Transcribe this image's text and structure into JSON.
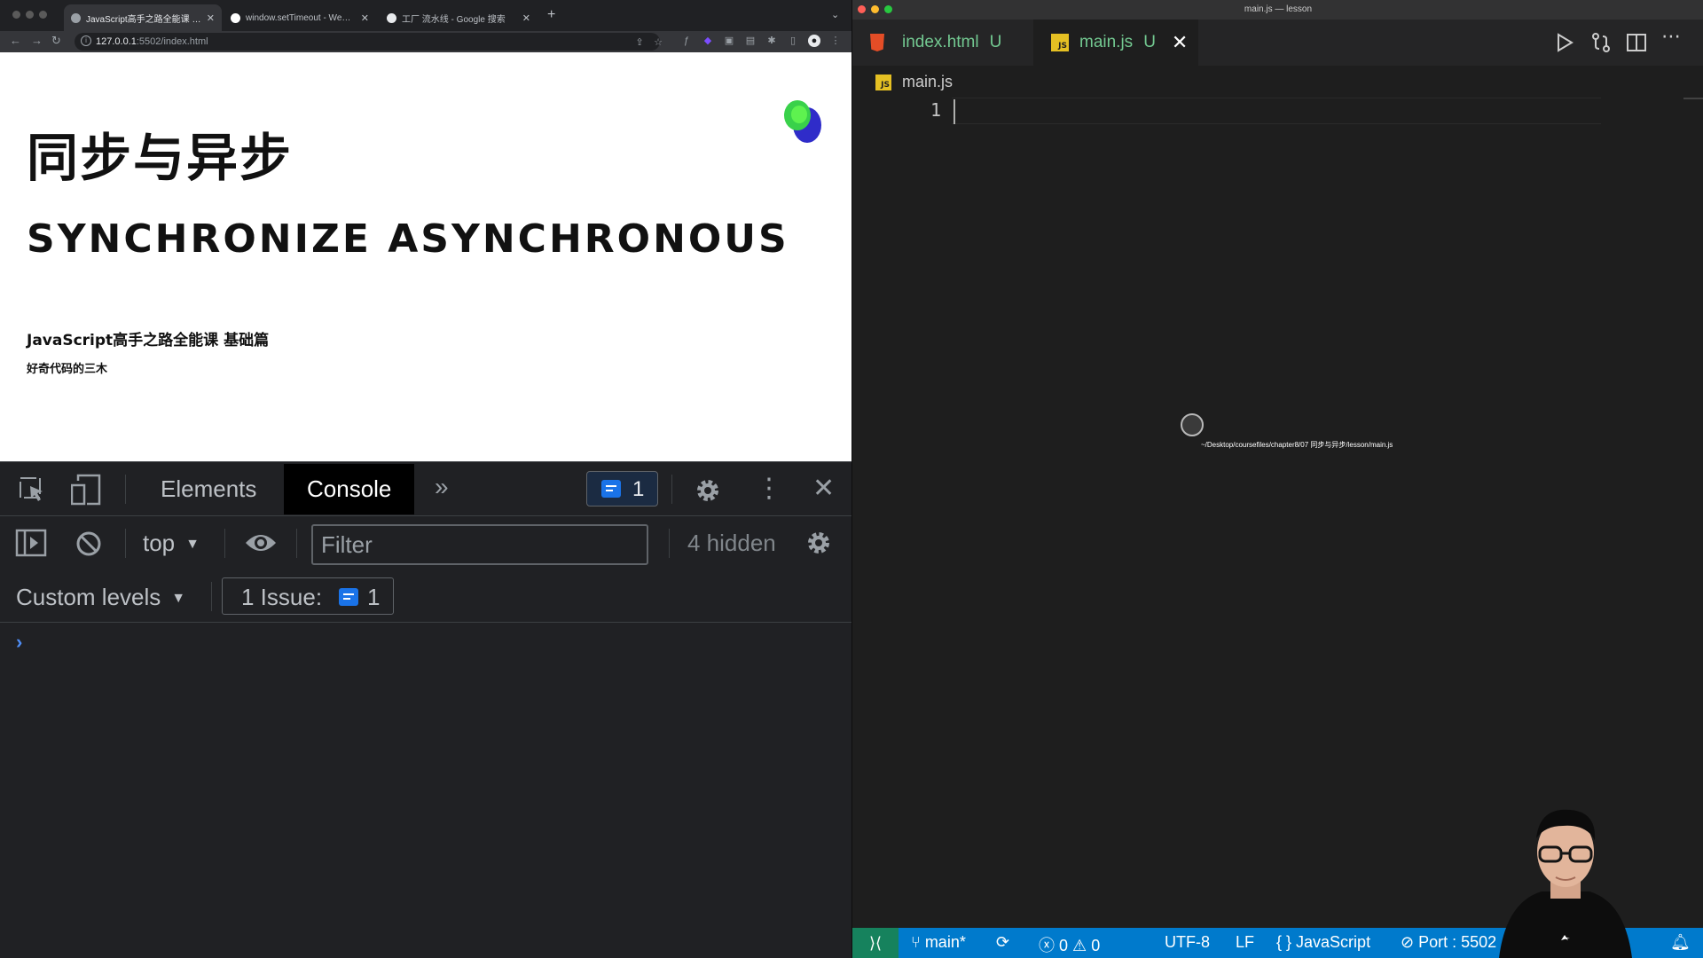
{
  "browser": {
    "tabs": [
      {
        "title": "JavaScript高手之路全能课 基础篇",
        "active": true
      },
      {
        "title": "window.setTimeout - Web API",
        "active": false
      },
      {
        "title": "工厂 流水线 - Google 搜索",
        "active": false
      }
    ],
    "new_tab": "+",
    "url_host": "127.0.0.1",
    "url_rest": ":5502/index.html",
    "page": {
      "title_cn": "同步与异步",
      "title_en": "SYNCHRONIZE ASYNCHRONOUS",
      "subtitle": "JavaScript高手之路全能课 基础篇",
      "author": "好奇代码的三木"
    }
  },
  "devtools": {
    "tabs": {
      "elements": "Elements",
      "console": "Console"
    },
    "issue_count": "1",
    "context": "top",
    "filter_placeholder": "Filter",
    "hidden": "4 hidden",
    "levels": "Custom levels",
    "issues_label": "1 Issue:",
    "issues_count": "1",
    "prompt": "›"
  },
  "vscode": {
    "title": "main.js — lesson",
    "tabs": [
      {
        "name": "index.html",
        "status": "U",
        "icon": "html5-icon"
      },
      {
        "name": "main.js",
        "status": "U",
        "icon": "javascript-icon",
        "close": "✕"
      }
    ],
    "breadcrumb": "main.js",
    "js_badge": "JS",
    "line_number": "1",
    "tooltip_path": "~/Desktop/coursefiles/chapter8/07 同步与异步/lesson/main.js",
    "status": {
      "branch": "main*",
      "errors": "0",
      "warnings": "0",
      "encoding": "UTF-8",
      "eol": "LF",
      "language": "JavaScript",
      "port": "Port : 5502"
    }
  },
  "colors": {
    "status_bar": "#007acc",
    "remote": "#16825d",
    "untracked": "#73c991",
    "devtools_bg": "#202124",
    "editor_bg": "#1e1e1e"
  }
}
